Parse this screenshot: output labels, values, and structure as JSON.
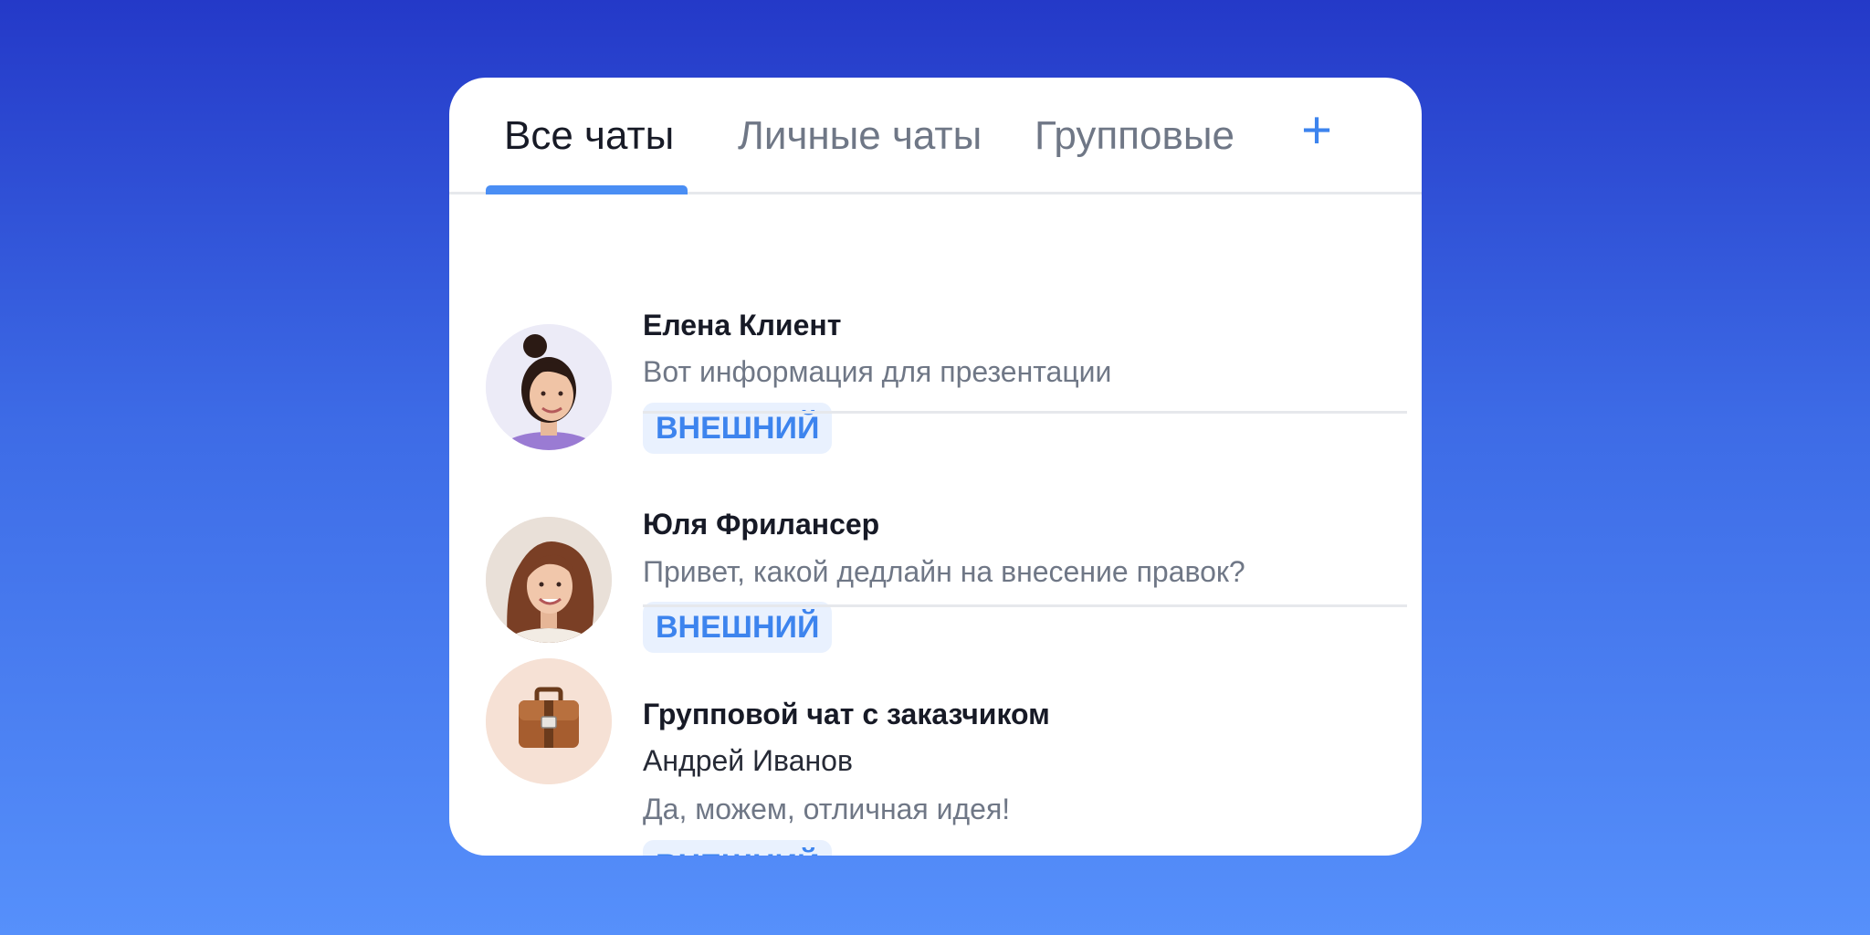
{
  "tabs": [
    {
      "label": "Все чаты",
      "active": true
    },
    {
      "label": "Личные чаты",
      "active": false
    },
    {
      "label": "Групповые",
      "active": false
    }
  ],
  "add_tab_label": "+",
  "colors": {
    "accent": "#3d84ee",
    "badge_bg": "#e9f1fe",
    "text_primary": "#171a26",
    "text_secondary": "#6f7786"
  },
  "chats": [
    {
      "name": "Елена Клиент",
      "preview": "Вот информация для презентации",
      "badge": "ВНЕШНИЙ",
      "avatar": "woman-with-bun-photo"
    },
    {
      "name": "Юля Фрилансер",
      "preview": "Привет, какой дедлайн на внесение правок?",
      "badge": "ВНЕШНИЙ",
      "avatar": "woman-with-wavy-hair-photo"
    },
    {
      "name": "Групповой чат с заказчиком",
      "sender": "Андрей Иванов",
      "preview": "Да, можем, отличная идея!",
      "badge": "ВНЕШНИЙ",
      "avatar": "briefcase-icon"
    }
  ]
}
